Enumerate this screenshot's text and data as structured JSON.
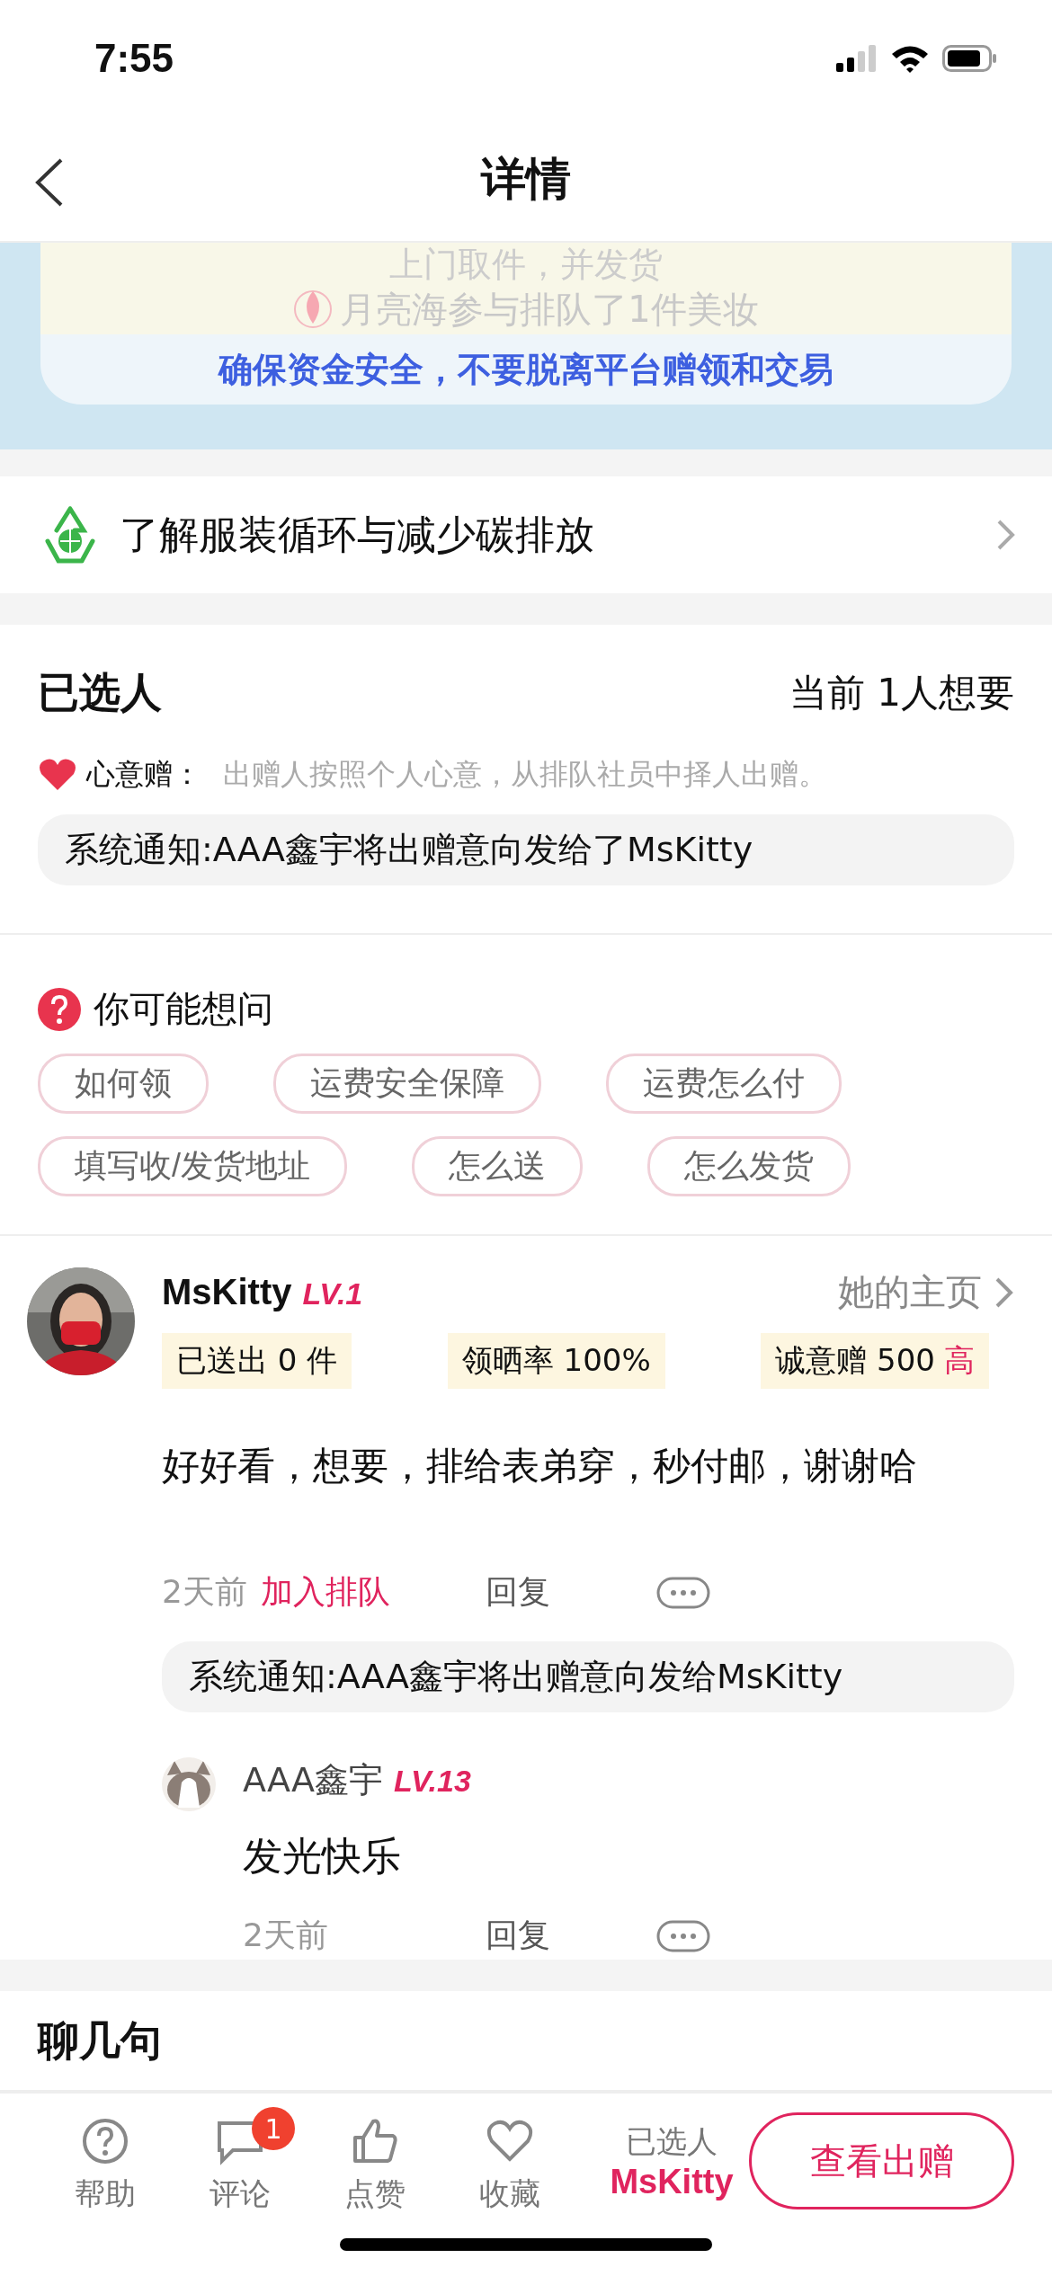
{
  "status_bar": {
    "time": "7:55"
  },
  "header": {
    "title": "详情"
  },
  "banner": {
    "cut_text": "上门取件，并发货",
    "toast": "月亮海参与排队了1件美妆",
    "notice": "确保资金安全，不要脱离平台赠领和交易"
  },
  "eco_link": {
    "label": "了解服装循环与减少碳排放"
  },
  "selected_section": {
    "title": "已选人",
    "count": "当前 1人想要",
    "mode_label": "心意赠：",
    "mode_desc": "出赠人按照个人心意，从排队社员中择人出赠。",
    "notice": "系统通知:AAA鑫宇将出赠意向发给了MsKitty"
  },
  "faq": {
    "title": "你可能想问",
    "chips": [
      {
        "label": "如何领"
      },
      {
        "label": "运费安全保障"
      },
      {
        "label": "运费怎么付"
      },
      {
        "label": "填写收/发货地址"
      },
      {
        "label": "怎么送"
      },
      {
        "label": "怎么发货"
      }
    ]
  },
  "comment": {
    "user": "MsKitty",
    "level": "LV.1",
    "profile_link": "她的主页",
    "stats": [
      {
        "label": "已送出 0 件"
      },
      {
        "label": "领晒率 100%"
      },
      {
        "label": "诚意赠 500",
        "badge": "高"
      }
    ],
    "text": "好好看，想要，排给表弟穿，秒付邮，谢谢哈",
    "time": "2天前",
    "action": "加入排队",
    "reply": "回复",
    "notice": "系统通知:AAA鑫宇将出赠意向发给MsKitty",
    "replies": [
      {
        "user": "AAA鑫宇",
        "level": "LV.13",
        "text": "发光快乐",
        "time": "2天前",
        "reply": "回复"
      }
    ]
  },
  "chat": {
    "title": "聊几句"
  },
  "bottom_bar": {
    "items": [
      {
        "kind": "help",
        "label": "帮助"
      },
      {
        "kind": "comment",
        "label": "评论",
        "badge": "1"
      },
      {
        "kind": "like",
        "label": "点赞"
      },
      {
        "kind": "favorite",
        "label": "收藏"
      }
    ],
    "selected_label": "已选人",
    "selected_user": "MsKitty",
    "button": "查看出赠"
  }
}
